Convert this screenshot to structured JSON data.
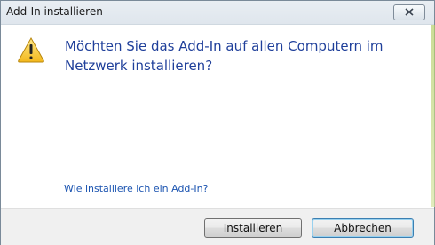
{
  "window": {
    "title": "Add-In installieren"
  },
  "dialog": {
    "icon": "warning-icon",
    "question": "Möchten Sie das Add-In auf allen Computern im Netzwerk installieren?",
    "help_link": "Wie installiere ich ein Add-In?"
  },
  "buttons": {
    "install_label": "Installieren",
    "cancel_label": "Abbrechen"
  },
  "colors": {
    "question_text": "#1f3f9a",
    "link": "#1a53b0",
    "footer_bg": "#f0f0f0"
  }
}
